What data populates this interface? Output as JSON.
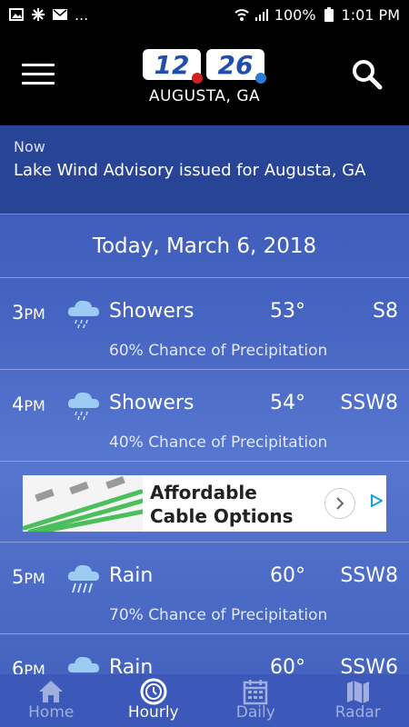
{
  "status_bar": {
    "battery": "100%",
    "time": "1:01 PM",
    "more": "..."
  },
  "header": {
    "logo_left": "12",
    "logo_right": "26",
    "location": "AUGUSTA, GA"
  },
  "alert": {
    "label": "Now",
    "message": "Lake Wind Advisory issued for Augusta, GA"
  },
  "date": "Today, March 6, 2018",
  "hours": [
    {
      "hour": "3",
      "ampm": "PM",
      "condition": "Showers",
      "temp": "53°",
      "wind": "S8",
      "precip": "60% Chance of Precipitation",
      "icon": "showers-icon"
    },
    {
      "hour": "4",
      "ampm": "PM",
      "condition": "Showers",
      "temp": "54°",
      "wind": "SSW8",
      "precip": "40% Chance of Precipitation",
      "icon": "showers-icon"
    },
    {
      "hour": "5",
      "ampm": "PM",
      "condition": "Rain",
      "temp": "60°",
      "wind": "SSW8",
      "precip": "70% Chance of Precipitation",
      "icon": "rain-icon"
    },
    {
      "hour": "6",
      "ampm": "PM",
      "condition": "Rain",
      "temp": "60°",
      "wind": "SSW6",
      "icon": "rain-icon"
    }
  ],
  "ad": {
    "title": "Affordable Cable Options"
  },
  "nav": [
    {
      "label": "Home",
      "icon": "home-icon",
      "active": false
    },
    {
      "label": "Hourly",
      "icon": "clock-icon",
      "active": true
    },
    {
      "label": "Daily",
      "icon": "calendar-icon",
      "active": false
    },
    {
      "label": "Radar",
      "icon": "map-icon",
      "active": false
    }
  ],
  "colors": {
    "header_bg": "#000000",
    "content_bg": "#3b56b5",
    "alert_bg": "#284496",
    "nav_bg": "#3c58b8",
    "icon_cloud": "#9ccbf3"
  }
}
